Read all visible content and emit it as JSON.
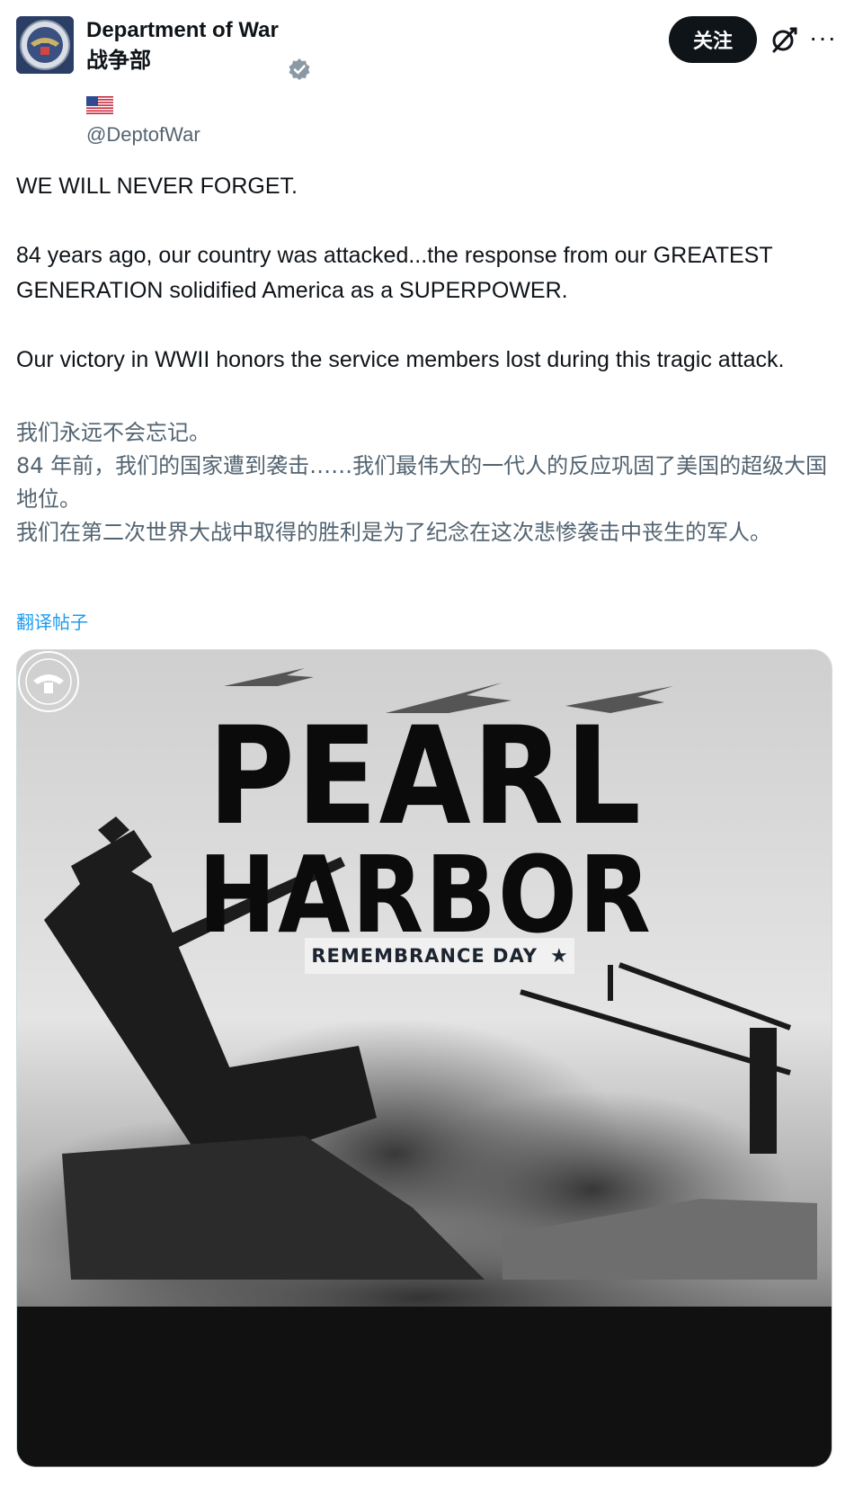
{
  "account": {
    "display_name": "Department of War",
    "display_name_zh": "战争部",
    "handle": "@DeptofWar",
    "flag_icon": "us-flag-icon",
    "verified_icon": "verified-badge-icon",
    "verified_color": "#8b99a6"
  },
  "actions": {
    "follow_label": "关注",
    "grok_icon": "grok-icon",
    "more_label": "···"
  },
  "post": {
    "paragraphs": [
      "WE WILL NEVER FORGET.",
      "84 years ago, our country was attacked...the response from our GREATEST GENERATION solidified America as a SUPERPOWER.",
      "Our victory in WWII honors the service members lost during this tragic attack."
    ],
    "translation_lines": [
      "我们永远不会忘记。",
      "84 年前，我们的国家遭到袭击……我们最伟大的一代人的反应巩固了美国的超级大国地位。",
      "我们在第二次世界大战中取得的胜利是为了纪念在这次悲惨袭击中丧生的军人。"
    ],
    "translate_link": "翻译帖子"
  },
  "media": {
    "title_line_1": "PEARL",
    "title_line_2": "HARBOR",
    "subtitle": "REMEMBRANCE DAY",
    "star": "★",
    "seal_icon": "department-seal-icon"
  },
  "colors": {
    "text_primary": "#0f1419",
    "text_secondary": "#536471",
    "link": "#1d9bf0",
    "button_bg": "#0f1419"
  }
}
